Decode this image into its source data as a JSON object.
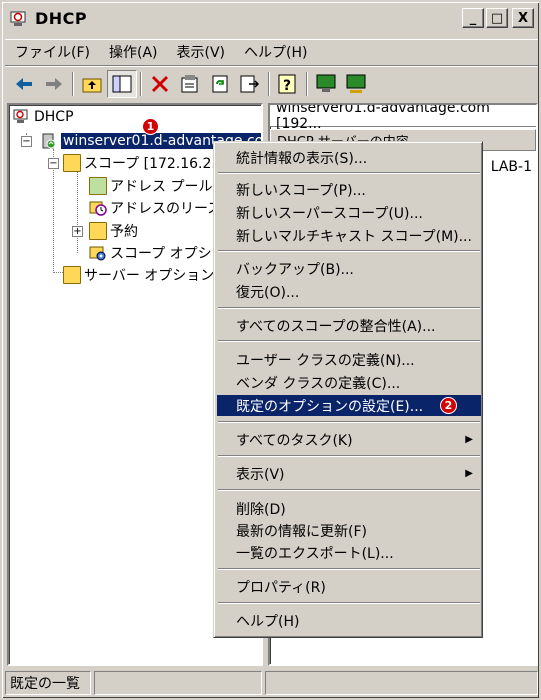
{
  "window": {
    "title": "DHCP"
  },
  "title_buttons": {
    "minimize": "_",
    "maximize": "□",
    "close": "X"
  },
  "menubar": [
    {
      "label": "ファイル(F)"
    },
    {
      "label": "操作(A)"
    },
    {
      "label": "表示(V)"
    },
    {
      "label": "ヘルプ(H)"
    }
  ],
  "toolbar": {
    "icons": [
      "back-arrow-icon",
      "forward-arrow-icon",
      "up-folder-icon",
      "show-hide-tree-icon",
      "delete-icon",
      "properties-icon",
      "refresh-icon",
      "export-icon",
      "help-icon",
      "monitor-icon",
      "monitor-network-icon"
    ]
  },
  "tree": {
    "root": "DHCP",
    "server": "winserver01.d-advantage.co",
    "scope": "スコープ [172.16.2.",
    "children": [
      "アドレス プール",
      "アドレスのリース",
      "予約",
      "スコープ オプシ"
    ],
    "server_options": "サーバー オプション"
  },
  "right_pane": {
    "header": "winserver01.d-advantage.com [192...",
    "column": "DHCP サーバーの内容",
    "item_fragment": "LAB-1"
  },
  "context_menu": {
    "items": [
      {
        "label": "統計情報の表示(S)..."
      },
      {
        "label": "新しいスコープ(P)..."
      },
      {
        "label": "新しいスーパースコープ(U)..."
      },
      {
        "label": "新しいマルチキャスト スコープ(M)..."
      },
      {
        "label": "バックアップ(B)..."
      },
      {
        "label": "復元(O)..."
      },
      {
        "label": "すべてのスコープの整合性(A)..."
      },
      {
        "label": "ユーザー クラスの定義(N)..."
      },
      {
        "label": "ベンダ クラスの定義(C)..."
      },
      {
        "label": "既定のオプションの設定(E)...",
        "highlighted": true
      },
      {
        "label": "すべてのタスク(K)",
        "submenu": true
      },
      {
        "label": "表示(V)",
        "submenu": true
      },
      {
        "label": "削除(D)"
      },
      {
        "label": "最新の情報に更新(F)"
      },
      {
        "label": "一覧のエクスポート(L)..."
      },
      {
        "label": "プロパティ(R)"
      },
      {
        "label": "ヘルプ(H)"
      }
    ]
  },
  "badges": {
    "one": "1",
    "two": "2"
  },
  "colors": {
    "selection": "#0a246a",
    "badge": "#d40000"
  },
  "statusbar": {
    "text": "既定の一覧"
  }
}
